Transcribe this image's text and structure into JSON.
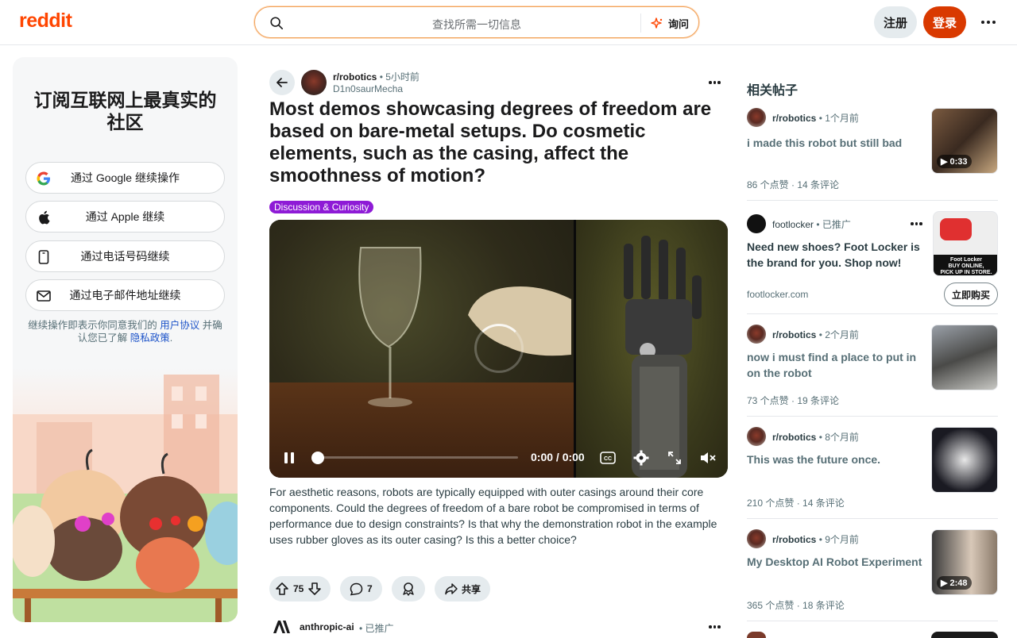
{
  "header": {
    "logo": "reddit",
    "search_placeholder": "查找所需一切信息",
    "ask_label": "询问",
    "signup_label": "注册",
    "login_label": "登录"
  },
  "left_panel": {
    "heading": "订阅互联网上最真实的社区",
    "buttons": [
      {
        "label": "通过 Google 继续操作",
        "icon": "google-icon"
      },
      {
        "label": "通过 Apple 继续",
        "icon": "apple-icon"
      },
      {
        "label": "通过电话号码继续",
        "icon": "phone-icon"
      },
      {
        "label": "通过电子邮件地址继续",
        "icon": "mail-icon"
      }
    ],
    "terms_prefix": "继续操作即表示你同意我们的",
    "terms_link": "用户协议",
    "terms_mid": "并确认您已了解",
    "privacy_link": "隐私政策",
    "terms_suffix": "."
  },
  "post": {
    "subreddit": "r/robotics",
    "time": "• 5小时前",
    "author": "D1n0saurMecha",
    "title": "Most demos showcasing degrees of freedom are based on bare-metal setups. Do cosmetic elements, such as the casing, affect the smoothness of motion?",
    "flair": "Discussion & Curiosity",
    "video_time": "0:00 / 0:00",
    "video_progress": 0,
    "body": "For aesthetic reasons, robots are typically equipped with outer casings around their core components. Could the degrees of freedom of a bare robot be compromised in terms of performance due to design constraints? Is that why the demonstration robot in the example uses rubber gloves as its outer casing? Is this a better choice?",
    "votes": "75",
    "comments": "7",
    "share_label": "共享"
  },
  "ad_row": {
    "name": "anthropic-ai",
    "tag": "• 已推广"
  },
  "related": {
    "heading": "相关帖子",
    "items": [
      {
        "sub": "r/robotics",
        "time": "• 1个月前",
        "title": "i made this robot but still bad",
        "stats": "86 个点赞  ·  14 条评论",
        "duration": "0:33"
      },
      {
        "sub": "footlocker",
        "time": "• 已推广",
        "title": "Need new shoes? Foot Locker is the brand for you. Shop now!",
        "domain": "footlocker.com",
        "button": "立即购买",
        "thumb_text_1": "Foot Locker",
        "thumb_text_2": "BUY ONLINE,",
        "thumb_text_3": "PICK UP IN STORE."
      },
      {
        "sub": "r/robotics",
        "time": "• 2个月前",
        "title": "now i must find a place to put in on the robot",
        "stats": "73 个点赞  ·  19 条评论"
      },
      {
        "sub": "r/robotics",
        "time": "• 8个月前",
        "title": "This was the future once.",
        "stats": "210 个点赞  ·  14 条评论"
      },
      {
        "sub": "r/robotics",
        "time": "• 9个月前",
        "title": "My Desktop AI Robot Experiment",
        "stats": "365 个点赞  ·  18 条评论",
        "duration": "2:48"
      }
    ]
  }
}
